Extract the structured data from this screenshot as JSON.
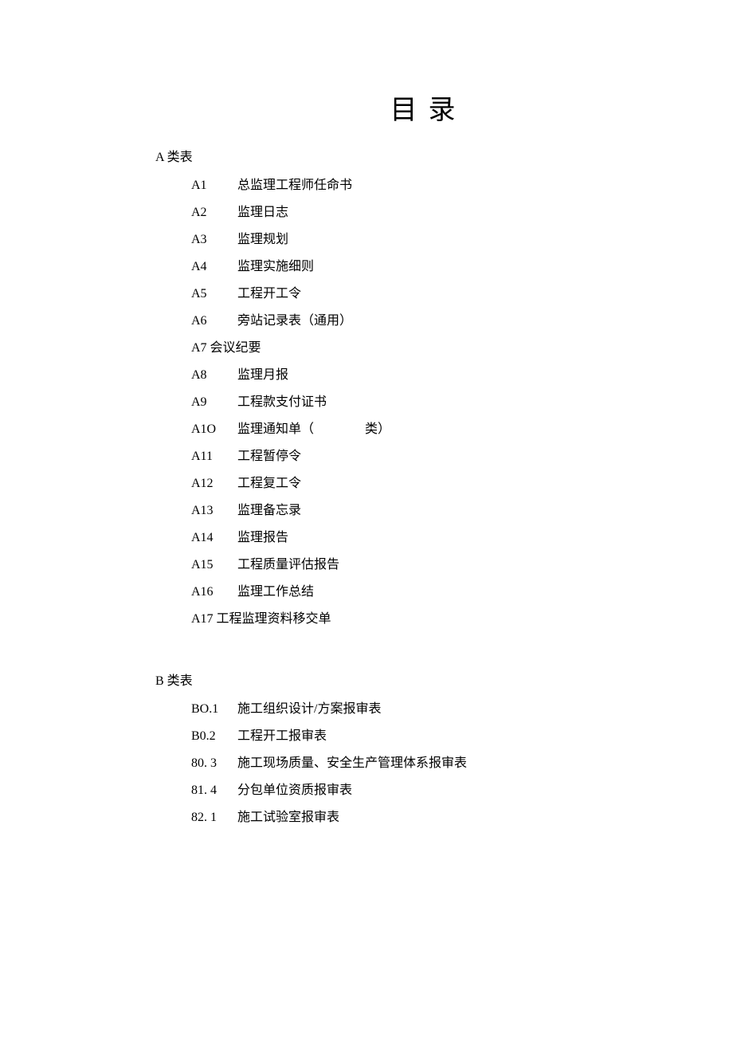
{
  "title": "目录",
  "sectionA": {
    "header": "A 类表",
    "items": [
      {
        "code": "A1",
        "label": "总监理工程师任命书",
        "style": "gap"
      },
      {
        "code": "A2",
        "label": "监理日志",
        "style": "gap"
      },
      {
        "code": "A3",
        "label": "监理规划",
        "style": "gap"
      },
      {
        "code": "A4",
        "label": "监理实施细则",
        "style": "gap"
      },
      {
        "code": "A5",
        "label": "工程开工令",
        "style": "gap"
      },
      {
        "code": "A6",
        "label": "旁站记录表（通用）",
        "style": "gap"
      },
      {
        "code": "A7 会议纪要",
        "label": "",
        "style": "nogap"
      },
      {
        "code": "A8",
        "label": "监理月报",
        "style": "gap"
      },
      {
        "code": "A9",
        "label": "工程款支付证书",
        "style": "gap"
      },
      {
        "code": "A1O",
        "label": "监理通知单（                类）",
        "style": "gap"
      },
      {
        "code": "A11",
        "label": "工程暂停令",
        "style": "gap"
      },
      {
        "code": "A12",
        "label": "工程复工令",
        "style": "gap"
      },
      {
        "code": "A13",
        "label": "监理备忘录",
        "style": "gap"
      },
      {
        "code": "A14",
        "label": "监理报告",
        "style": "gap"
      },
      {
        "code": "A15",
        "label": "工程质量评估报告",
        "style": "gap"
      },
      {
        "code": "A16",
        "label": "监理工作总结",
        "style": "gap"
      },
      {
        "code": "A17 工程监理资料移交单",
        "label": "",
        "style": "nogap"
      }
    ]
  },
  "sectionB": {
    "header": "B 类表",
    "items": [
      {
        "code": "BO.1",
        "label": "施工组织设计/方案报审表",
        "style": "gap"
      },
      {
        "code": "B0.2",
        "label": "工程开工报审表",
        "style": "gap"
      },
      {
        "code": "80.  3",
        "label": "施工现场质量、安全生产管理体系报审表",
        "style": "gap"
      },
      {
        "code": "81.  4",
        "label": "分包单位资质报审表",
        "style": "gap"
      },
      {
        "code": "82.  1",
        "label": "施工试验室报审表",
        "style": "gap"
      }
    ]
  }
}
